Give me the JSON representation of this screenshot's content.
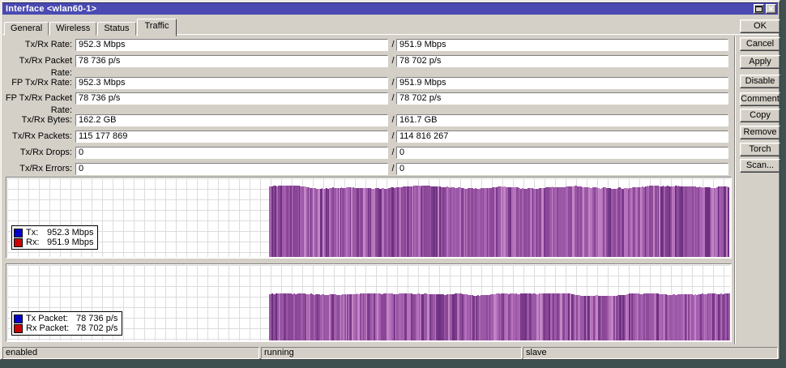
{
  "window": {
    "title": "Interface <wlan60-1>"
  },
  "separator": "/",
  "tabs": [
    {
      "label": "General"
    },
    {
      "label": "Wireless"
    },
    {
      "label": "Status"
    },
    {
      "label": "Traffic",
      "active": true
    }
  ],
  "fields": [
    {
      "label": "Tx/Rx Rate:",
      "tx": "952.3 Mbps",
      "rx": "951.9 Mbps"
    },
    {
      "label": "Tx/Rx Packet Rate:",
      "tx": "78 736 p/s",
      "rx": "78 702 p/s"
    },
    {
      "label": "FP Tx/Rx Rate:",
      "tx": "952.3 Mbps",
      "rx": "951.9 Mbps"
    },
    {
      "label": "FP Tx/Rx Packet Rate:",
      "tx": "78 736 p/s",
      "rx": "78 702 p/s"
    },
    {
      "label": "Tx/Rx Bytes:",
      "tx": "162.2 GB",
      "rx": "161.7 GB"
    },
    {
      "label": "Tx/Rx Packets:",
      "tx": "115 177 869",
      "rx": "114 816 267"
    },
    {
      "label": "Tx/Rx Drops:",
      "tx": "0",
      "rx": "0"
    },
    {
      "label": "Tx/Rx Errors:",
      "tx": "0",
      "rx": "0"
    }
  ],
  "buttons": [
    "OK",
    "Cancel",
    "Apply",
    "Disable",
    "Comment",
    "Copy",
    "Remove",
    "Torch",
    "Scan..."
  ],
  "statusbar": [
    "enabled",
    "running",
    "slave"
  ],
  "colors": {
    "titlebar": "#4a4ab2",
    "dialog_bg": "#d4d0c8",
    "desktop_bg": "#3e5050",
    "tx_legend": "#0000cc",
    "rx_legend": "#cc0000",
    "grid_line": "#dcdcdc"
  },
  "bar_palette": [
    "#9a58a6",
    "#8a4797",
    "#a967b3",
    "#7a3a8a",
    "#b873bd",
    "#6e3080",
    "#9a58a6",
    "#8d4b99",
    "#c286c4",
    "#a55fb0"
  ],
  "charts": [
    {
      "name": "traffic-rate-graph",
      "legend": [
        {
          "label": "Tx:",
          "value": "952.3 Mbps",
          "color": "#0000cc"
        },
        {
          "label": "Rx:",
          "value": "951.9 Mbps",
          "color": "#cc0000"
        }
      ],
      "bars": {
        "start_fraction": 0.362,
        "top_fraction": 0.11,
        "jitter": 0.02,
        "seed": 7
      }
    },
    {
      "name": "packet-rate-graph",
      "legend": [
        {
          "label": "Tx Packet:",
          "value": "78 736 p/s",
          "color": "#0000cc"
        },
        {
          "label": "Rx Packet:",
          "value": "78 702 p/s",
          "color": "#cc0000"
        }
      ],
      "bars": {
        "start_fraction": 0.362,
        "top_fraction": 0.39,
        "jitter": 0.018,
        "seed": 13
      }
    }
  ],
  "chart_data": [
    {
      "type": "area",
      "title": "Tx/Rx rate history graph",
      "series": [
        {
          "name": "Tx",
          "current_value": "952.3 Mbps"
        },
        {
          "name": "Rx",
          "current_value": "951.9 Mbps"
        }
      ],
      "xlabel": "time (unlabeled)",
      "ylabel": "rate (unlabeled)",
      "grid": true,
      "legend_position": "bottom-left",
      "note": "steady ~952 Mbps traffic filling the right ~64% of the timeline; left ~36% idle"
    },
    {
      "type": "area",
      "title": "Tx/Rx packet rate history graph",
      "series": [
        {
          "name": "Tx Packet",
          "current_value": "78 736 p/s"
        },
        {
          "name": "Rx Packet",
          "current_value": "78 702 p/s"
        }
      ],
      "xlabel": "time (unlabeled)",
      "ylabel": "packets per second (unlabeled)",
      "grid": true,
      "legend_position": "bottom-left",
      "note": "steady ~78 700 p/s traffic filling the right ~64% of the timeline; left ~36% idle"
    }
  ]
}
